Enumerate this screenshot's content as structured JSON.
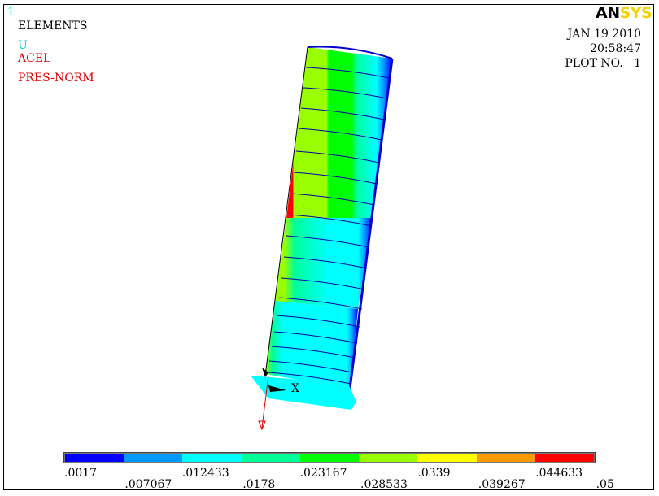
{
  "window_number": "1",
  "legend": {
    "elements": "ELEMENTS",
    "u": "U",
    "acel": "ACEL",
    "pres_norm": "PRES-NORM",
    "colors": {
      "elements": "#000000",
      "u": "#00c8c8",
      "acel": "#e00000",
      "pres_norm": "#e00000"
    }
  },
  "date_block": {
    "date": "JAN 19 2010",
    "time": "20:58:47",
    "plot": "PLOT NO.   1"
  },
  "logo": {
    "part1": "AN",
    "part2": "SYS"
  },
  "axis_label": "X",
  "colorbar": {
    "colors": [
      "#0000ff",
      "#0099ff",
      "#00ffff",
      "#00ff99",
      "#00ff00",
      "#99ff00",
      "#ffff00",
      "#ff9900",
      "#ff0000"
    ],
    "labels_top": [
      ".0017",
      ".012433",
      ".023167",
      ".0339",
      ".044633"
    ],
    "labels_bottom": [
      ".007067",
      ".0178",
      ".028533",
      ".039267",
      ".05"
    ]
  }
}
